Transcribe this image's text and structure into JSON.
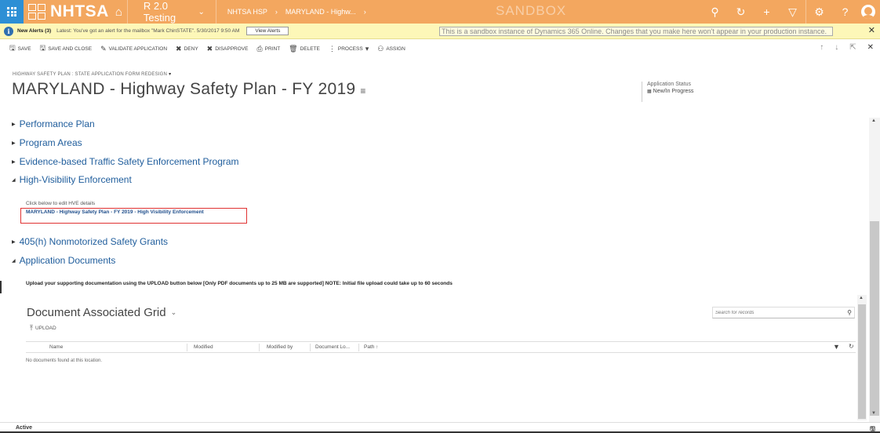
{
  "topbar": {
    "logo_text": "NHTSA",
    "area": "R 2.0 Testing",
    "breadcrumb": [
      "NHTSA HSP",
      "MARYLAND - Highw..."
    ],
    "sandbox_label": "SANDBOX",
    "colors": {
      "nav": "#f3a75f",
      "waffle": "#2d8fd5"
    },
    "icons": [
      "search-icon",
      "recent-icon",
      "plus-icon",
      "filter-icon",
      "gear-icon",
      "help-icon",
      "user-icon"
    ]
  },
  "alerts": {
    "label": "New Alerts (3)",
    "text": "Latest: You've got an alert for the mailbox \"Mark ChinSTATE\". 5/30/2017 9:50 AM",
    "view_button": "View Alerts",
    "sandbox_message": "This is a sandbox instance of Dynamics 365 Online. Changes that you make here won't appear in your production instance."
  },
  "commands": [
    {
      "label": "SAVE",
      "icon": "save-icon"
    },
    {
      "label": "SAVE AND CLOSE",
      "icon": "save-close-icon"
    },
    {
      "label": "VALIDATE APPLICATION",
      "icon": "validate-icon"
    },
    {
      "label": "DENY",
      "icon": "deny-icon"
    },
    {
      "label": "DISAPPROVE",
      "icon": "disapprove-icon"
    },
    {
      "label": "PRINT",
      "icon": "print-icon"
    },
    {
      "label": "DELETE",
      "icon": "delete-icon"
    },
    {
      "label": "PROCESS",
      "icon": "process-icon"
    },
    {
      "label": "ASSIGN",
      "icon": "assign-icon"
    }
  ],
  "header": {
    "form_selector": "HIGHWAY SAFETY PLAN : STATE APPLICATION FORM REDESIGN",
    "title": "MARYLAND - Highway Safety Plan - FY 2019",
    "status_label": "Application Status",
    "status_value": "New/In Progress"
  },
  "sections": [
    {
      "label": "Performance Plan",
      "expanded": false
    },
    {
      "label": "Program Areas",
      "expanded": false
    },
    {
      "label": "Evidence-based Traffic Safety Enforcement Program",
      "expanded": false
    },
    {
      "label": "High-Visibility Enforcement",
      "expanded": true
    },
    {
      "label": "405(h) Nonmotorized Safety Grants",
      "expanded": false
    },
    {
      "label": "Application Documents",
      "expanded": true
    }
  ],
  "hve": {
    "hint": "Click below to edit HVE details",
    "link": "MARYLAND - Highway Safety Plan - FY 2019 - High Visibility Enforcement"
  },
  "documents": {
    "upload_note": "Upload your supporting documentation using the UPLOAD button below [Only PDF documents up to 25 MB are supported] NOTE: Initial file upload could take up to 60 seconds",
    "grid_title": "Document Associated Grid",
    "upload_label": "UPLOAD",
    "search_placeholder": "Search for records",
    "columns": [
      "Name",
      "Modified",
      "Modified by",
      "Document Lo...",
      "Path ↑"
    ],
    "empty_message": "No documents found at this location."
  },
  "statusbar": {
    "state": "Active"
  }
}
